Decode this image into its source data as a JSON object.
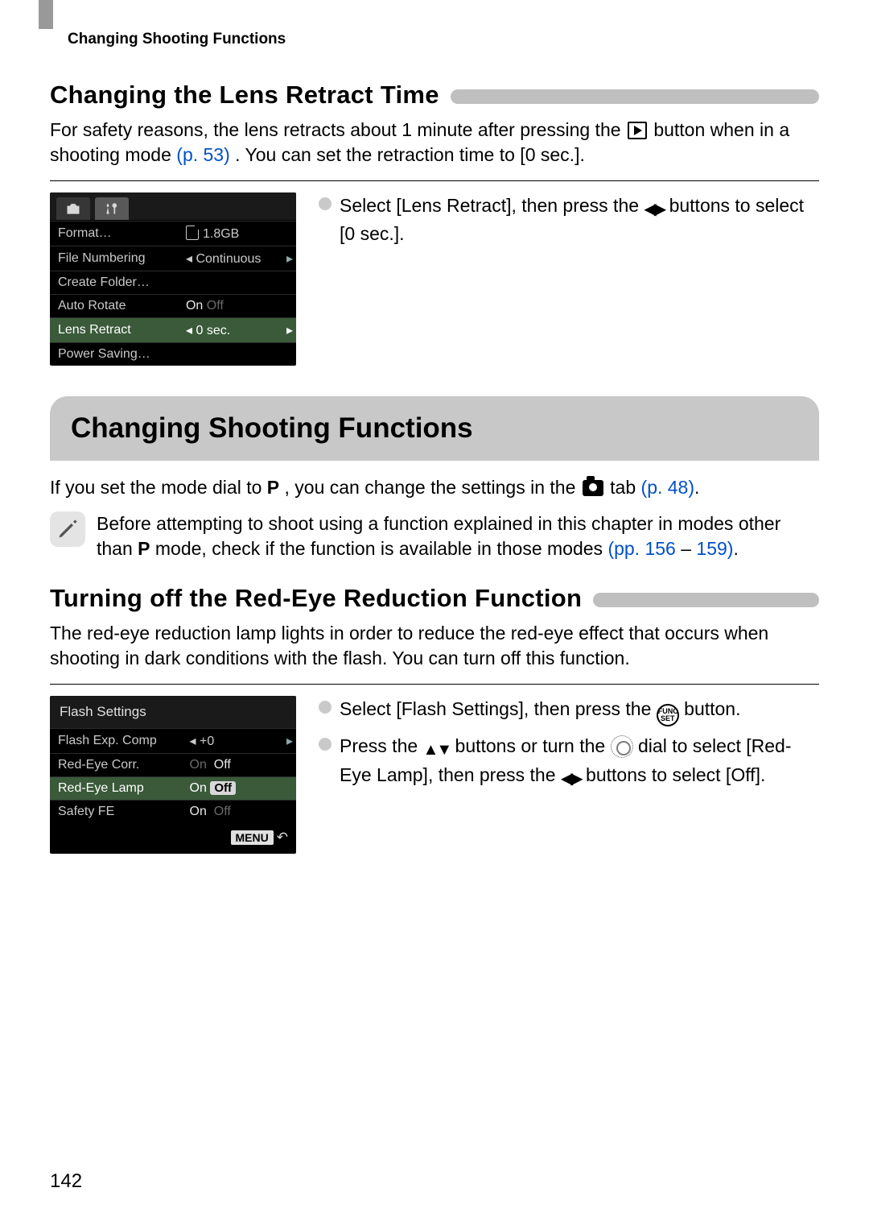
{
  "runningHead": "Changing Shooting Functions",
  "pageNumber": "142",
  "sec1": {
    "title": "Changing the Lens Retract Time",
    "body_a": "For safety reasons, the lens retracts about 1 minute after pressing the ",
    "body_b": " button when in a shooting mode ",
    "link1": "(p. 53)",
    "body_c": ". You can set the retraction time to [0 sec.].",
    "instr_a": "Select [Lens Retract], then press the ",
    "instr_b": " buttons to select [0 sec.]."
  },
  "lcd1": {
    "rows": [
      {
        "label": "Format…",
        "value_prefix_icon": "sd",
        "value": "1.8GB"
      },
      {
        "label": "File Numbering",
        "value": "Continuous",
        "left_arrow": true,
        "right_arrow": true
      },
      {
        "label": "Create Folder…",
        "value": ""
      },
      {
        "label": "Auto Rotate",
        "value_on": "On",
        "value_off": "Off"
      },
      {
        "label": "Lens Retract",
        "value": "0 sec.",
        "left_arrow": true,
        "right_arrow": true,
        "selected": true
      },
      {
        "label": "Power Saving…",
        "value": ""
      }
    ]
  },
  "banner": "Changing Shooting Functions",
  "para2_a": "If you set the mode dial to ",
  "para2_b": ", you can change the settings in the ",
  "para2_c": " tab ",
  "para2_link": "(p. 48)",
  "para2_d": ".",
  "callout_a": "Before attempting to shoot using a function explained in this chapter in modes other than ",
  "callout_b": " mode, check if the function is available in those modes ",
  "callout_link1": "(pp. 156",
  "callout_dash": " – ",
  "callout_link2": "159)",
  "callout_c": ".",
  "sec2": {
    "title": "Turning off the Red-Eye Reduction Function",
    "body": "The red-eye reduction lamp lights in order to reduce the red-eye effect that occurs when shooting in dark conditions with the flash. You can turn off this function.",
    "instr1_a": "Select [Flash Settings], then press the ",
    "instr1_b": " button.",
    "instr2_a": "Press the ",
    "instr2_b": " buttons or turn the ",
    "instr2_c": " dial to select [Red-Eye Lamp], then press the ",
    "instr2_d": " buttons to select [Off]."
  },
  "lcd2": {
    "title": "Flash Settings",
    "rows": [
      {
        "label": "Flash Exp. Comp",
        "value": "+0",
        "left_arrow": true,
        "right_arrow": true
      },
      {
        "label": "Red-Eye Corr.",
        "value_on": "On",
        "value_off": "Off",
        "on_dim": true
      },
      {
        "label": "Red-Eye Lamp",
        "value_on": "On",
        "value_off_box": "Off",
        "selected": true
      },
      {
        "label": "Safety FE",
        "value_on": "On",
        "value_off": "Off",
        "off_dim": true
      }
    ],
    "menuLabel": "MENU"
  }
}
